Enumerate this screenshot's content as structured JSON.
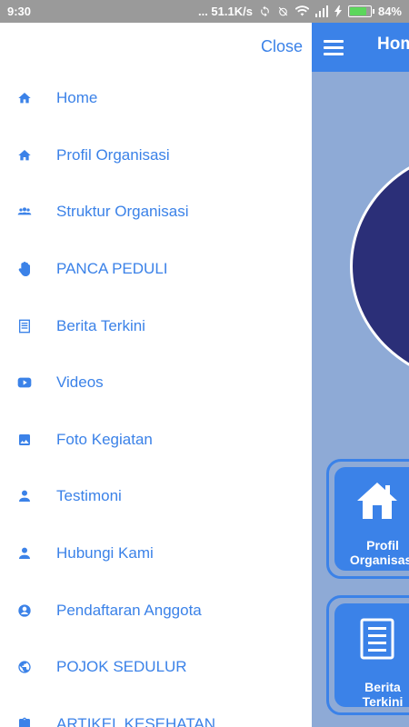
{
  "status_bar": {
    "time": "9:30",
    "network_speed": "... 51.1K/s",
    "battery_percent": "84%",
    "battery_level": 0.84
  },
  "drawer": {
    "close_label": "Close",
    "items": [
      {
        "label": "Home",
        "icon": "home-icon"
      },
      {
        "label": "Profil Organisasi",
        "icon": "home-small-icon"
      },
      {
        "label": "Struktur Organisasi",
        "icon": "group-icon"
      },
      {
        "label": "PANCA PEDULI",
        "icon": "hand-icon"
      },
      {
        "label": "Berita Terkini",
        "icon": "news-icon"
      },
      {
        "label": "Videos",
        "icon": "youtube-icon"
      },
      {
        "label": "Foto Kegiatan",
        "icon": "image-icon"
      },
      {
        "label": "Testimoni",
        "icon": "person-icon"
      },
      {
        "label": "Hubungi Kami",
        "icon": "person-icon"
      },
      {
        "label": "Pendaftaran Anggota",
        "icon": "account-circle-icon"
      },
      {
        "label": "POJOK SEDULUR",
        "icon": "globe-icon"
      },
      {
        "label": "ARTIKEL KESEHATAN",
        "icon": "clipboard-icon"
      }
    ]
  },
  "app": {
    "title": "Hom",
    "colors": {
      "primary": "#3b82e8",
      "background": "#8eaad6",
      "logo": "#2b2f78"
    },
    "tiles": [
      {
        "label_line1": "Profil",
        "label_line2": "Organisasi",
        "icon": "house-icon"
      },
      {
        "label_line1": "Berita",
        "label_line2": "Terkini",
        "icon": "news-icon"
      }
    ]
  }
}
